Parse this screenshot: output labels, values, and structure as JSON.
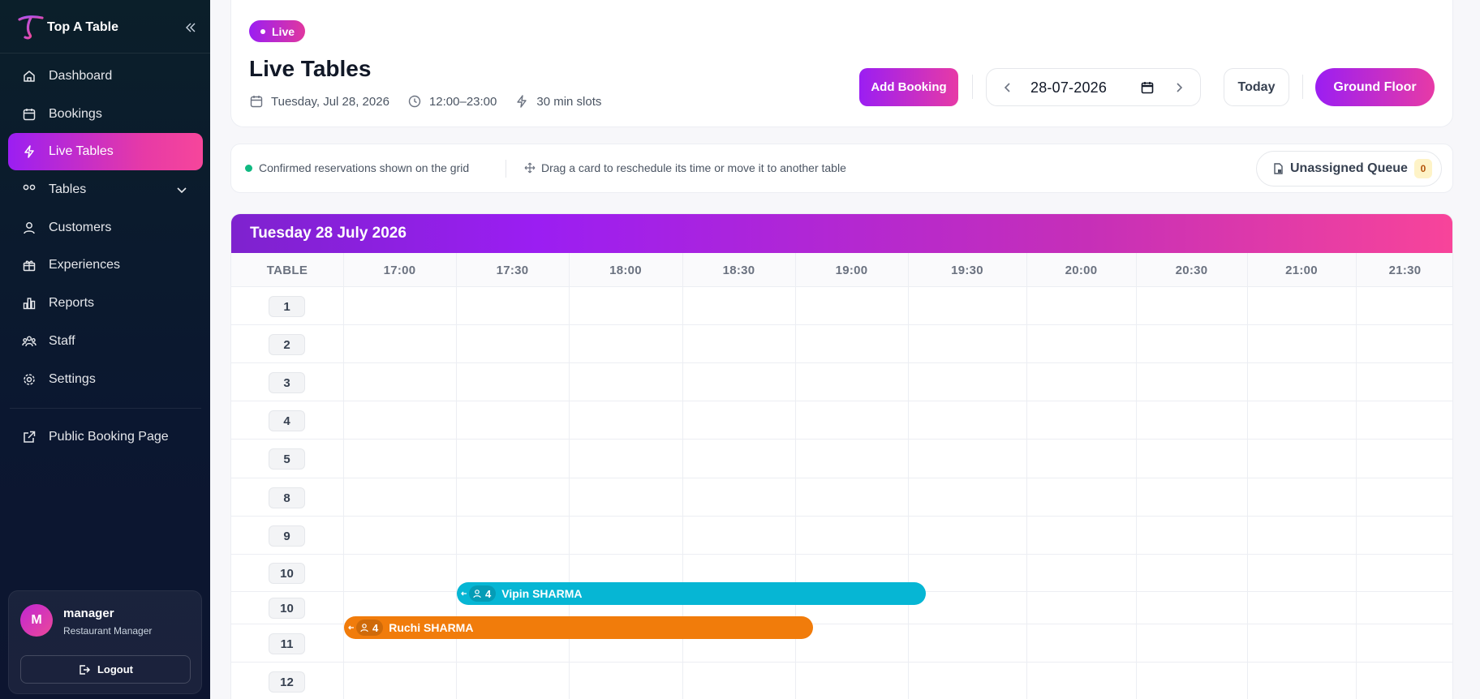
{
  "brand": {
    "name": "Top A Table"
  },
  "nav": {
    "items": [
      {
        "label": "Dashboard",
        "icon": "home-icon"
      },
      {
        "label": "Bookings",
        "icon": "calendar-icon"
      },
      {
        "label": "Live Tables",
        "icon": "bolt-icon",
        "active": true
      },
      {
        "label": "Tables",
        "icon": "tables-icon",
        "expandable": true
      },
      {
        "label": "Customers",
        "icon": "user-icon"
      },
      {
        "label": "Experiences",
        "icon": "gift-icon"
      },
      {
        "label": "Reports",
        "icon": "bar-chart-icon"
      },
      {
        "label": "Staff",
        "icon": "users-icon"
      },
      {
        "label": "Settings",
        "icon": "gear-icon"
      }
    ],
    "public_link": "Public Booking Page"
  },
  "user": {
    "initial": "M",
    "name": "manager",
    "role": "Restaurant Manager",
    "logout_label": "Logout"
  },
  "header": {
    "badge": "Live",
    "title": "Live Tables",
    "date_text": "Tuesday, Jul 28, 2026",
    "hours_text": "12:00–23:00",
    "slots_text": "30 min slots",
    "add_booking_label": "Add Booking",
    "date_value": "28-07-2026",
    "today_label": "Today",
    "floor_label": "Ground Floor"
  },
  "info": {
    "confirmed_text": "Confirmed reservations shown on the grid",
    "drag_text": "Drag a card to reschedule its time or move it to another table",
    "queue_label": "Unassigned Queue",
    "queue_count": "0"
  },
  "grid": {
    "title": "Tuesday 28 July 2026",
    "table_header": "TABLE",
    "times": [
      "17:00",
      "17:30",
      "18:00",
      "18:30",
      "19:00",
      "19:30",
      "20:00",
      "20:30",
      "21:00",
      "21:30"
    ],
    "rows": [
      "1",
      "2",
      "3",
      "4",
      "5",
      "8",
      "9",
      "10",
      "10",
      "11",
      "12"
    ],
    "bookings": [
      {
        "name": "Vipin SHARMA",
        "party": "4",
        "table": "10",
        "start": "17:30",
        "end": "19:30",
        "color": "#06b6d4"
      },
      {
        "name": "Ruchi SHARMA",
        "party": "4",
        "table": "11",
        "start": "17:00",
        "end": "19:00",
        "color": "#f17c0b"
      }
    ]
  },
  "colors": {
    "accent_start": "#9b1ef2",
    "accent_end": "#e73aa6",
    "sidebar_bg": "#0b1f2a"
  }
}
